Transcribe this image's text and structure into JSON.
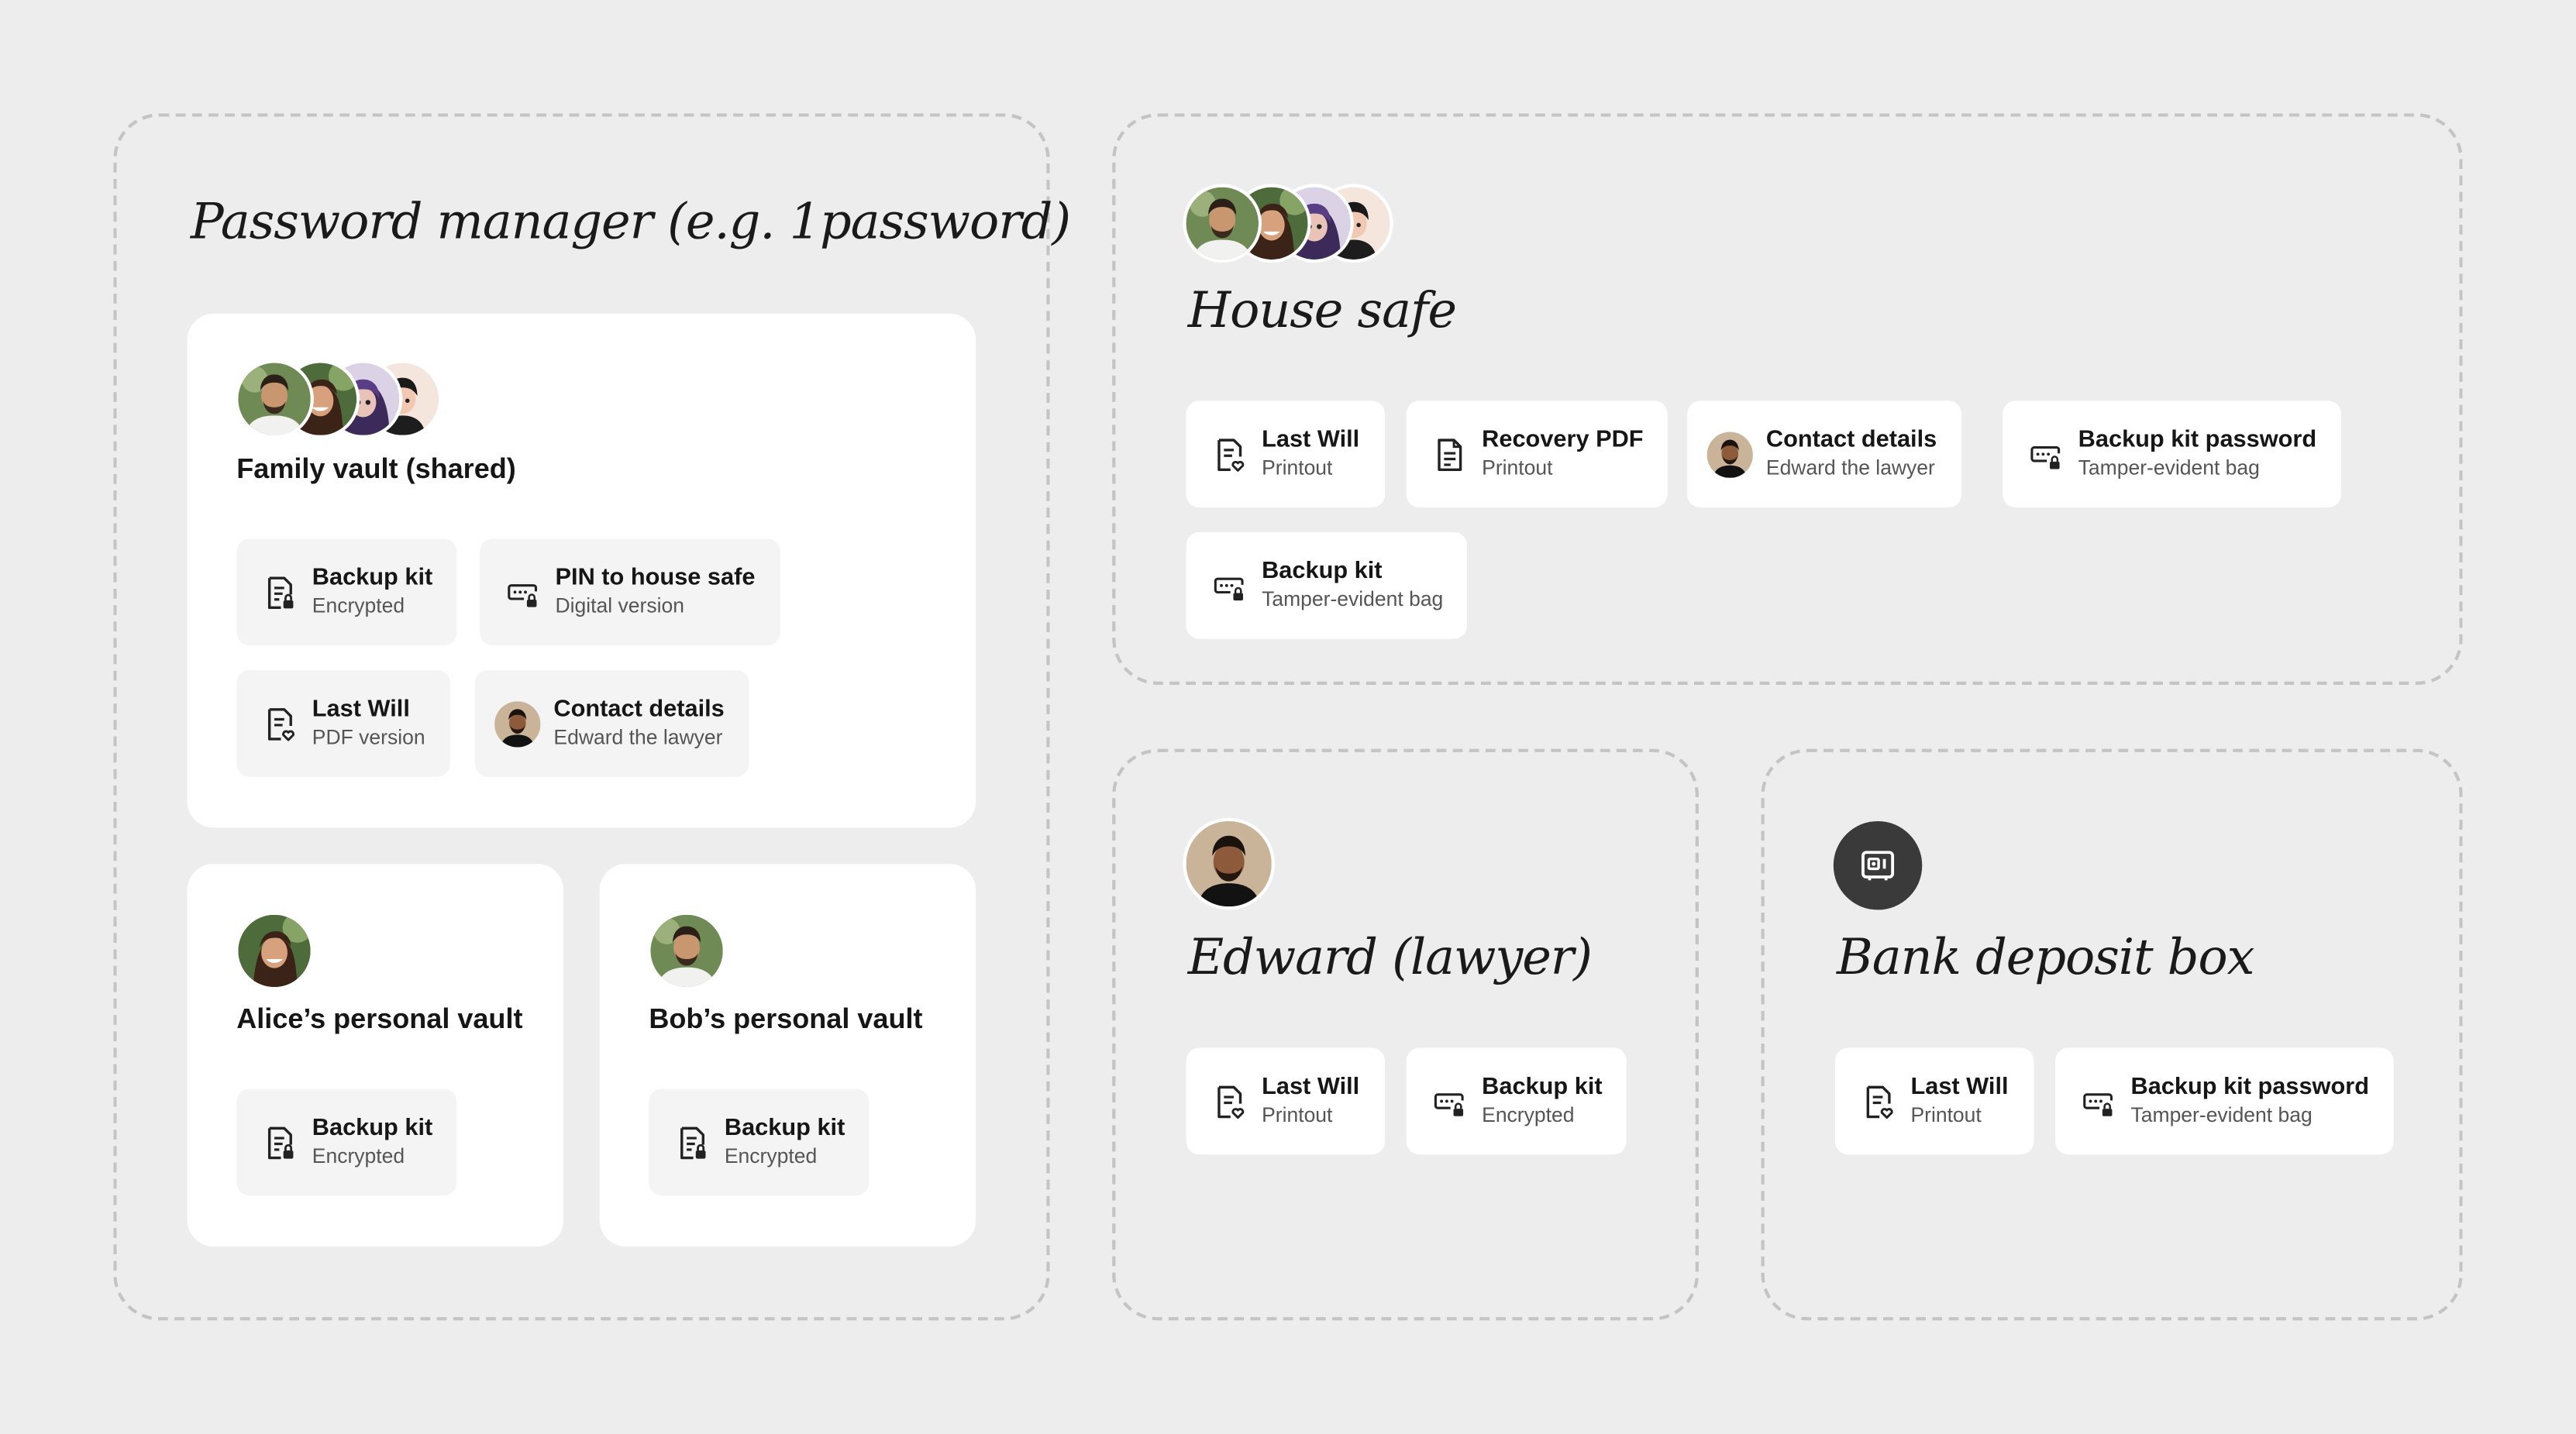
{
  "password_manager": {
    "title": "Password manager (e.g. 1password)",
    "family_vault": {
      "title": "Family vault (shared)",
      "items": [
        {
          "name": "Backup kit",
          "sub": "Encrypted",
          "icon": "document-lock-icon"
        },
        {
          "name": "PIN to house safe",
          "sub": "Digital version",
          "icon": "password-lock-icon"
        },
        {
          "name": "Last Will",
          "sub": "PDF version",
          "icon": "document-heart-icon"
        },
        {
          "name": "Contact details",
          "sub": "Edward the lawyer",
          "icon": "lawyer-avatar"
        }
      ]
    },
    "alice_vault": {
      "title": "Alice’s personal vault",
      "items": [
        {
          "name": "Backup kit",
          "sub": "Encrypted",
          "icon": "document-lock-icon"
        }
      ]
    },
    "bob_vault": {
      "title": "Bob’s personal vault",
      "items": [
        {
          "name": "Backup kit",
          "sub": "Encrypted",
          "icon": "document-lock-icon"
        }
      ]
    }
  },
  "house_safe": {
    "title": "House safe",
    "items": [
      {
        "name": "Last Will",
        "sub": "Printout",
        "icon": "document-heart-icon"
      },
      {
        "name": "Recovery PDF",
        "sub": "Printout",
        "icon": "document-icon"
      },
      {
        "name": "Contact details",
        "sub": "Edward the lawyer",
        "icon": "lawyer-avatar"
      },
      {
        "name": "Backup kit password",
        "sub": "Tamper-evident bag",
        "icon": "password-lock-icon"
      },
      {
        "name": "Backup kit",
        "sub": "Tamper-evident bag",
        "icon": "password-lock-icon"
      }
    ]
  },
  "edward": {
    "title": "Edward (lawyer)",
    "items": [
      {
        "name": "Last Will",
        "sub": "Printout",
        "icon": "document-heart-icon"
      },
      {
        "name": "Backup kit",
        "sub": "Encrypted",
        "icon": "password-lock-icon"
      }
    ]
  },
  "bank": {
    "title": "Bank deposit box",
    "icon": "safe-icon",
    "items": [
      {
        "name": "Last Will",
        "sub": "Printout",
        "icon": "document-heart-icon"
      },
      {
        "name": "Backup kit password",
        "sub": "Tamper-evident bag",
        "icon": "password-lock-icon"
      }
    ]
  },
  "colors": {
    "background": "#ededed",
    "card": "#ffffff",
    "item_grey": "#f4f4f4",
    "dashed_border": "#c4c4c4",
    "bank_icon_bg": "#3a3a3a"
  }
}
